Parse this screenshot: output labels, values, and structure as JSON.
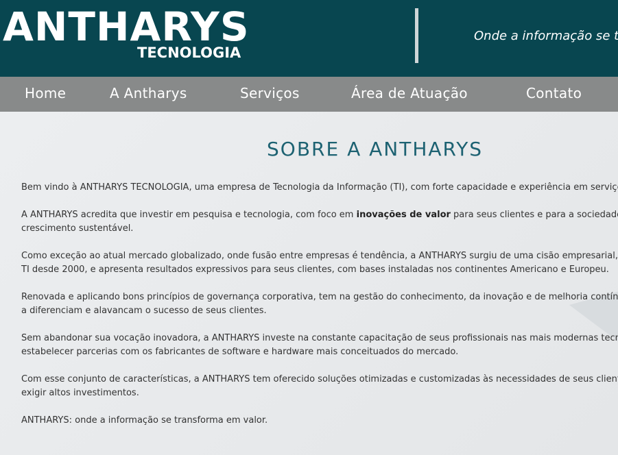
{
  "header": {
    "logo_main": "ANTHARYS",
    "logo_sub": "TECNOLOGIA",
    "tagline": "Onde a informação se transforma em valor"
  },
  "nav": {
    "items": [
      {
        "label": "Home"
      },
      {
        "label": "A Antharys"
      },
      {
        "label": "Serviços"
      },
      {
        "label": "Área de Atuação"
      },
      {
        "label": "Contato"
      }
    ]
  },
  "main": {
    "title": "SOBRE A ANTHARYS",
    "p1": "Bem vindo à ANTHARYS TECNOLOGIA, uma empresa de Tecnologia da Informação (TI), com forte capacidade e experiência em serviços de",
    "p2_a": "A ANTHARYS acredita que investir em pesquisa e tecnologia, com foco em ",
    "p2_bold": "inovações de valor",
    "p2_b": " para seus clientes e para a sociedade, será o",
    "p2_c": "crescimento sustentável.",
    "p3_a": "Como exceção ao atual mercado globalizado, onde fusão entre empresas é tendência, a ANTHARYS surgiu de uma cisão empresarial, com",
    "p3_b": "TI desde 2000, e apresenta resultados expressivos para seus clientes, com bases instaladas nos continentes Americano e Europeu.",
    "p4_a": "Renovada e aplicando bons princípios de governança corporativa, tem na gestão do conhecimento, da inovação e de melhoria contínua os",
    "p4_b": "a diferenciam e alavancam o sucesso de seus clientes.",
    "p5_a": "Sem abandonar sua vocação inovadora, a ANTHARYS investe na constante capacitação de seus profissionais nas mais modernas tecnologias",
    "p5_b": "estabelecer parcerias com os fabricantes de software e hardware mais conceituados do mercado.",
    "p6_a": "Com esse conjunto de características, a ANTHARYS tem oferecido soluções otimizadas e customizadas às necessidades de seus clientes, ge",
    "p6_b": "exigir altos investimentos.",
    "p7": "ANTHARYS: onde a informação se transforma em valor."
  },
  "colors": {
    "header_bg": "#084650",
    "nav_bg": "#888a8a",
    "title": "#1d6272",
    "body_text": "#333333"
  }
}
